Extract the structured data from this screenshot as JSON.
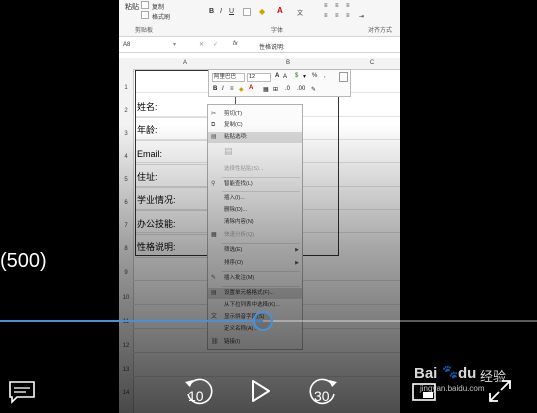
{
  "ribbon": {
    "paste_label": "粘贴",
    "copy_label": "复制",
    "format_painter_label": "格式刷",
    "clipboard_group": "剪贴板",
    "font_group": "字体",
    "alignment_group": "对齐方式"
  },
  "formula_bar": {
    "name_box": "A8",
    "fx": "fx",
    "value": "性格说明:"
  },
  "columns": [
    "A",
    "B",
    "C"
  ],
  "rows": [
    "1",
    "2",
    "3",
    "4",
    "5",
    "6",
    "7",
    "8",
    "9",
    "10",
    "11",
    "12",
    "13",
    "14"
  ],
  "cells": [
    "姓名:",
    "年龄:",
    "Email:",
    "住址:",
    "学业情况:",
    "办公技能:",
    "性格说明:"
  ],
  "mini_toolbar": {
    "font_name": "阿里巴巴",
    "font_size": "12",
    "percent": "%"
  },
  "context_menu": [
    {
      "label": "剪切(T)",
      "disabled": false
    },
    {
      "label": "复制(C)",
      "disabled": false
    },
    {
      "label": "粘贴选项:",
      "disabled": false
    },
    {
      "label": "",
      "disabled": true
    },
    {
      "label": "选择性粘贴(S)...",
      "disabled": true
    },
    {
      "label": "智能查找(L)",
      "disabled": false
    },
    {
      "label": "插入(I)...",
      "disabled": false
    },
    {
      "label": "删除(D)...",
      "disabled": false
    },
    {
      "label": "清除内容(N)",
      "disabled": false
    },
    {
      "label": "快速分析(Q)",
      "disabled": true
    },
    {
      "label": "筛选(E)",
      "disabled": false
    },
    {
      "label": "排序(O)",
      "disabled": false
    },
    {
      "label": "插入批注(M)",
      "disabled": false
    },
    {
      "label": "设置单元格格式(F)...",
      "disabled": false
    },
    {
      "label": "从下拉列表中选择(K)...",
      "disabled": false
    },
    {
      "label": "显示拼音字段(S)",
      "disabled": false
    },
    {
      "label": "定义名称(A)...",
      "disabled": false
    },
    {
      "label": "链接(I)",
      "disabled": false
    }
  ],
  "video": {
    "time_label": "(500)",
    "rewind_label": "10",
    "forward_label": "30",
    "progress": 0.49
  },
  "watermark": {
    "brand": "Bai",
    "brand2": "du",
    "suffix": "经验",
    "url": "jingyan.baidu.com"
  },
  "colors": {
    "accent": "#4a90d9"
  }
}
